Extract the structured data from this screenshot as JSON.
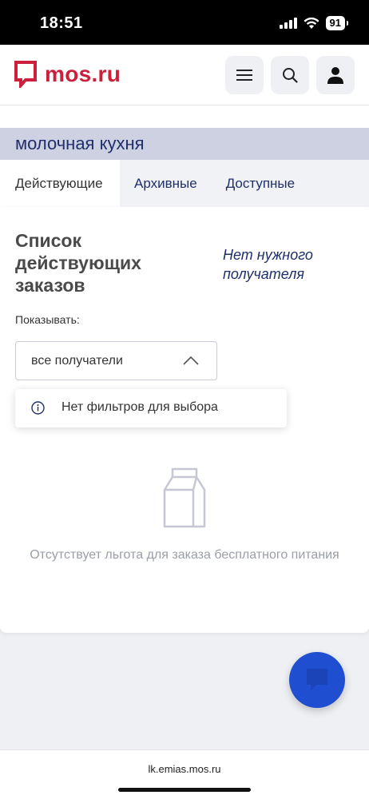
{
  "status_bar": {
    "time": "18:51",
    "battery": "91"
  },
  "header": {
    "logo_text": "mos.ru"
  },
  "cut_text": "- - - - -",
  "section": {
    "title": "молочная кухня"
  },
  "tabs": [
    {
      "label": "Действующие",
      "active": true
    },
    {
      "label": "Архивные",
      "active": false
    },
    {
      "label": "Доступные",
      "active": false
    }
  ],
  "main": {
    "list_title": "Список действующих заказов",
    "no_recipient_link": "Нет нужного получателя",
    "show_label": "Показывать:",
    "select_value": "все получатели",
    "dropdown_message": "Нет фильтров для выбора",
    "empty_text": "Отсутствует льгота для заказа бесплатного питания"
  },
  "browser": {
    "url": "lk.emias.mos.ru"
  },
  "colors": {
    "brand_red": "#cc1f3b",
    "navy": "#1f2f6b",
    "chat_blue": "#1f4fd0"
  }
}
